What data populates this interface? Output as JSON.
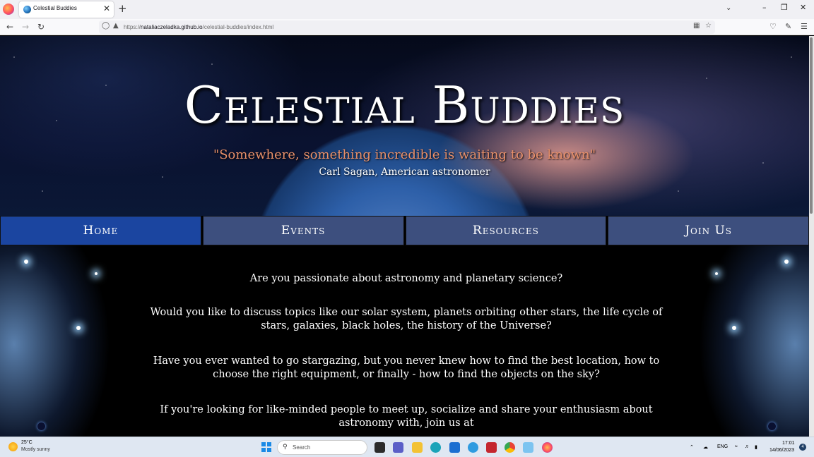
{
  "browser": {
    "tab_title": "Celestial Buddies",
    "tab_close": "✕",
    "new_tab": "+",
    "url_prefix": "https://",
    "url_host": "nataliaczeladka.github.io",
    "url_path": "/celestial-buddies/index.html",
    "icons": [
      "back-icon",
      "forward-icon",
      "reload-icon",
      "shield-icon",
      "lock-icon",
      "reader-view-icon",
      "bookmark-star-icon",
      "pocket-icon",
      "extensions-icon",
      "menu-icon"
    ]
  },
  "site": {
    "title": "Celestial Buddies",
    "quote": "\"Somewhere, something incredible is waiting to be known\"",
    "quote_author": "Carl Sagan, American astronomer",
    "nav": [
      {
        "label": "Home",
        "active": true
      },
      {
        "label": "Events",
        "active": false
      },
      {
        "label": "Resources",
        "active": false
      },
      {
        "label": "Join Us",
        "active": false
      }
    ],
    "paragraphs": [
      "Are you passionate about astronomy and planetary science?",
      "Would you like to discuss topics like our solar system, planets orbiting other stars, the life cycle of stars, galaxies, black holes, the history of the Universe?",
      "Have you ever wanted to go stargazing, but you never knew how to find the best location, how to choose the right equipment, or finally - how to find the objects on the sky?",
      "If you're looking for like-minded people to meet up, socialize and share your enthusiasm about astronomy with, join us at"
    ],
    "colors": {
      "menu": "#3d4f7e",
      "menu_active": "#1b45a0",
      "quote": "#e8906a"
    }
  },
  "taskbar": {
    "weather_temp": "25°C",
    "weather_condition": "Mostly sunny",
    "search_label": "Search",
    "language": "ENG",
    "time": "17:01",
    "date": "14/06/2023",
    "notification_count": "4"
  }
}
